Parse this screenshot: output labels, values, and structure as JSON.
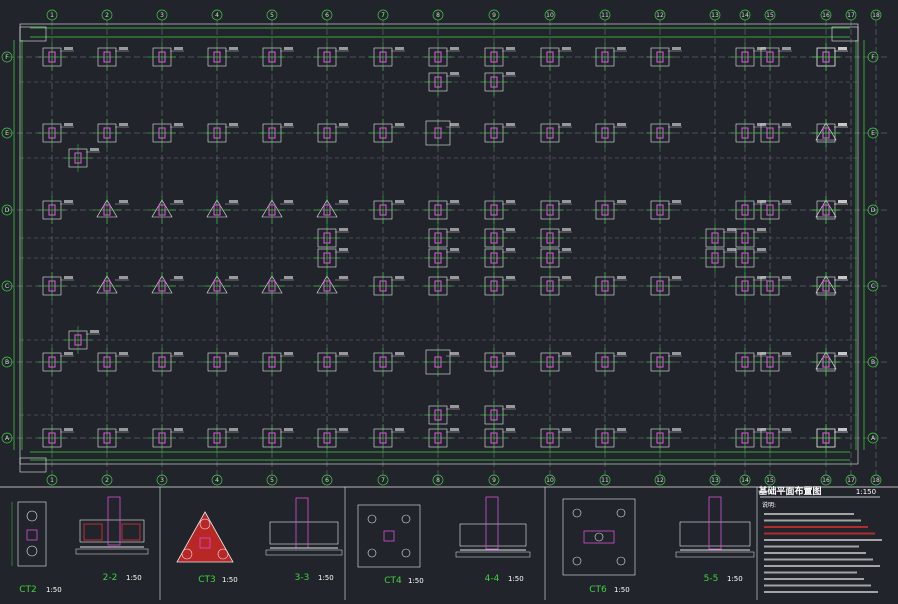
{
  "drawing": {
    "title": "基础平面布置图",
    "scale": "1:150",
    "notes_heading": "说明:",
    "column_axes": [
      "1",
      "2",
      "3",
      "4",
      "5",
      "6",
      "7",
      "8",
      "9",
      "10",
      "11",
      "12",
      "13",
      "14",
      "15",
      "16",
      "17",
      "18"
    ],
    "row_axes": [
      "F",
      "E",
      "D",
      "C",
      "B",
      "A"
    ],
    "colors": {
      "background": "#21252b",
      "axis": "#3fd23f",
      "foundation": "#d94fd9",
      "outline": "#e8e8e8",
      "rebar": "#e03030"
    }
  },
  "details": [
    {
      "id": "ct2",
      "label": "CT2",
      "scale": "1:50"
    },
    {
      "id": "sec22",
      "label": "2-2",
      "scale": "1:50"
    },
    {
      "id": "ct3",
      "label": "CT3",
      "scale": "1:50"
    },
    {
      "id": "sec33",
      "label": "3-3",
      "scale": "1:50"
    },
    {
      "id": "ct4",
      "label": "CT4",
      "scale": "1:50"
    },
    {
      "id": "sec44",
      "label": "4-4",
      "scale": "1:50"
    },
    {
      "id": "ct6",
      "label": "CT6",
      "scale": "1:50"
    },
    {
      "id": "sec55",
      "label": "5-5",
      "scale": "1:50"
    }
  ]
}
